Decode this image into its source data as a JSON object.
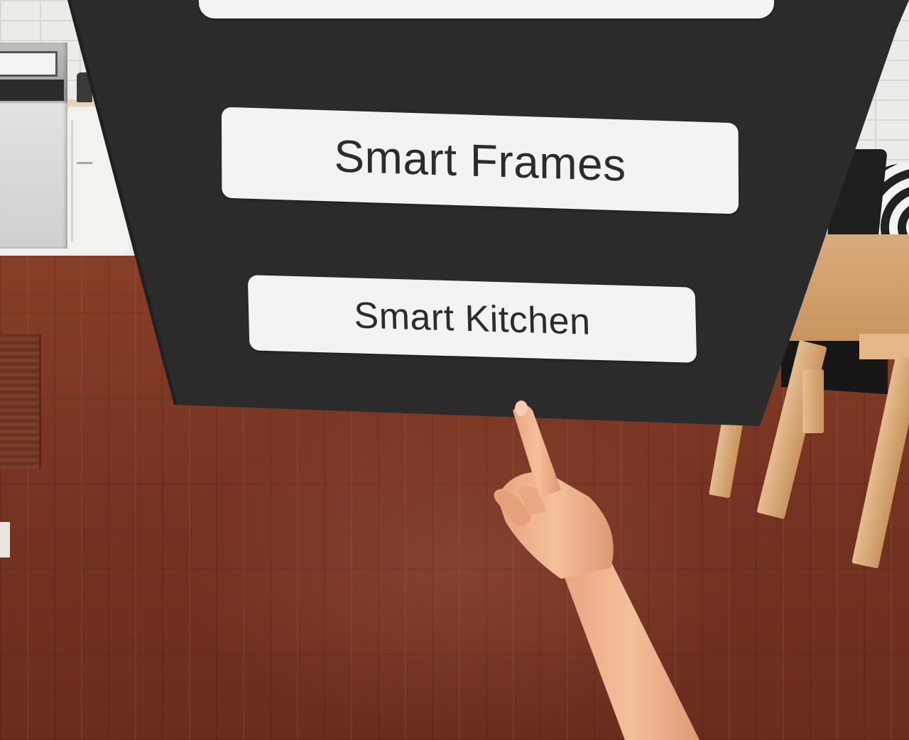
{
  "menu": {
    "items": [
      {
        "label": ""
      },
      {
        "label": "Smart Frames"
      },
      {
        "label": "Smart Kitchen"
      }
    ]
  },
  "colors": {
    "panel": "#2b2b2b",
    "button": "#f4f3f4",
    "button_text": "#2c2c2c",
    "floor": "#7a3522",
    "skin": "#f0b48c"
  },
  "icons": {
    "hand": "pointing-hand-icon"
  }
}
